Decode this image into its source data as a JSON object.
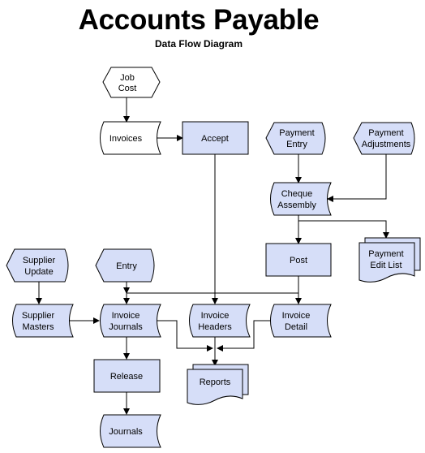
{
  "header": {
    "title": "Accounts Payable",
    "subtitle": "Data Flow Diagram"
  },
  "colors": {
    "fill": "#D6DEF8",
    "white_fill": "#FFFFFF",
    "stroke": "#000000"
  },
  "nodes": {
    "job_cost": {
      "type": "external-entity",
      "lines": [
        "Job",
        "Cost"
      ]
    },
    "invoices": {
      "type": "data-store",
      "lines": [
        "Invoices"
      ]
    },
    "accept": {
      "type": "process",
      "lines": [
        "Accept"
      ]
    },
    "payment_entry": {
      "type": "external-entity",
      "lines": [
        "Payment",
        "Entry"
      ]
    },
    "payment_adjustments": {
      "type": "external-entity",
      "lines": [
        "Payment",
        "Adjustments"
      ]
    },
    "cheque_assembly": {
      "type": "data-store",
      "lines": [
        "Cheque",
        "Assembly"
      ]
    },
    "post": {
      "type": "process",
      "lines": [
        "Post"
      ]
    },
    "payment_edit_list": {
      "type": "report",
      "lines": [
        "Payment",
        "Edit List"
      ]
    },
    "supplier_update": {
      "type": "external-entity",
      "lines": [
        "Supplier",
        "Update"
      ]
    },
    "entry": {
      "type": "external-entity",
      "lines": [
        "Entry"
      ]
    },
    "supplier_masters": {
      "type": "data-store",
      "lines": [
        "Supplier",
        "Masters"
      ]
    },
    "invoice_journals": {
      "type": "data-store",
      "lines": [
        "Invoice",
        "Journals"
      ]
    },
    "invoice_headers": {
      "type": "data-store",
      "lines": [
        "Invoice",
        "Headers"
      ]
    },
    "invoice_detail": {
      "type": "data-store",
      "lines": [
        "Invoice",
        "Detail"
      ]
    },
    "reports": {
      "type": "report",
      "lines": [
        "Reports"
      ]
    },
    "release": {
      "type": "process",
      "lines": [
        "Release"
      ]
    },
    "journals": {
      "type": "data-store",
      "lines": [
        "Journals"
      ]
    }
  },
  "flows": [
    {
      "from": "Job Cost",
      "to": "Invoices"
    },
    {
      "from": "Invoices",
      "to": "Accept"
    },
    {
      "from": "Accept",
      "to": "Invoice Headers"
    },
    {
      "from": "Payment Entry",
      "to": "Cheque Assembly"
    },
    {
      "from": "Payment Adjustments",
      "to": "Cheque Assembly"
    },
    {
      "from": "Cheque Assembly",
      "to": "Post"
    },
    {
      "from": "Cheque Assembly",
      "to": "Payment Edit List"
    },
    {
      "from": "Post",
      "to": "Invoice Detail"
    },
    {
      "from": "Entry",
      "to": "Invoice Journals"
    },
    {
      "from": "Entry",
      "to": "Invoice Headers"
    },
    {
      "from": "Entry",
      "to": "Invoice Detail"
    },
    {
      "from": "Supplier Update",
      "to": "Supplier Masters"
    },
    {
      "from": "Supplier Masters",
      "to": "Invoice Journals"
    },
    {
      "from": "Invoice Journals",
      "to": "Release"
    },
    {
      "from": "Release",
      "to": "Journals"
    },
    {
      "from": "Invoice Journals",
      "to": "Reports"
    },
    {
      "from": "Invoice Headers",
      "to": "Reports"
    },
    {
      "from": "Invoice Detail",
      "to": "Reports"
    }
  ]
}
